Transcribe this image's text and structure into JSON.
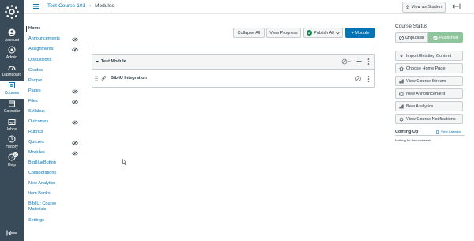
{
  "global_nav": {
    "items": [
      {
        "label": "Account",
        "icon": "account-icon"
      },
      {
        "label": "Admin",
        "icon": "admin-icon"
      },
      {
        "label": "Dashboard",
        "icon": "dashboard-icon"
      },
      {
        "label": "Courses",
        "icon": "courses-icon"
      },
      {
        "label": "Calendar",
        "icon": "calendar-icon"
      },
      {
        "label": "Inbox",
        "icon": "inbox-icon"
      },
      {
        "label": "History",
        "icon": "history-icon"
      },
      {
        "label": "Help",
        "icon": "help-icon"
      }
    ],
    "help_badge": "10"
  },
  "header": {
    "course_name": "Test-Course-101",
    "separator": "›",
    "page": "Modules",
    "view_as_student": "View as Student"
  },
  "course_nav": {
    "items": [
      {
        "label": "Home",
        "hidden": false
      },
      {
        "label": "Announcements",
        "hidden": true
      },
      {
        "label": "Assignments",
        "hidden": true
      },
      {
        "label": "Discussions",
        "hidden": false
      },
      {
        "label": "Grades",
        "hidden": false
      },
      {
        "label": "People",
        "hidden": false
      },
      {
        "label": "Pages",
        "hidden": true
      },
      {
        "label": "Files",
        "hidden": true
      },
      {
        "label": "Syllabus",
        "hidden": false
      },
      {
        "label": "Outcomes",
        "hidden": true
      },
      {
        "label": "Rubrics",
        "hidden": false
      },
      {
        "label": "Quizzes",
        "hidden": true
      },
      {
        "label": "Modules",
        "hidden": true
      },
      {
        "label": "BigBlueButton",
        "hidden": false
      },
      {
        "label": "Collaborations",
        "hidden": false
      },
      {
        "label": "New Analytics",
        "hidden": false
      },
      {
        "label": "Item Banks",
        "hidden": false
      },
      {
        "label": "BibliU: Course Materials",
        "hidden": false
      },
      {
        "label": "Settings",
        "hidden": false
      }
    ]
  },
  "toolbar": {
    "collapse_all": "Collapse All",
    "view_progress": "View Progress",
    "publish_all": "Publish All",
    "add_module": "+ Module"
  },
  "module": {
    "title": "Test Module",
    "items": [
      {
        "title": "BibliU Integration"
      }
    ]
  },
  "sidebar": {
    "status_title": "Course Status",
    "unpublish": "Unpublish",
    "published": "Published",
    "actions": [
      {
        "label": "Import Existing Content",
        "icon": "import-icon"
      },
      {
        "label": "Choose Home Page",
        "icon": "home-icon"
      },
      {
        "label": "View Course Stream",
        "icon": "stream-icon"
      },
      {
        "label": "New Announcement",
        "icon": "announcement-icon"
      },
      {
        "label": "New Analytics",
        "icon": "analytics-icon"
      },
      {
        "label": "View Course Notifications",
        "icon": "bell-icon"
      }
    ],
    "coming_up_title": "Coming Up",
    "view_calendar": "View Calendar",
    "coming_up_empty": "Nothing for the next week"
  },
  "colors": {
    "nav_bg": "#394b58",
    "link": "#0374b5",
    "published": "#8fc59c",
    "success": "#0b874b"
  }
}
